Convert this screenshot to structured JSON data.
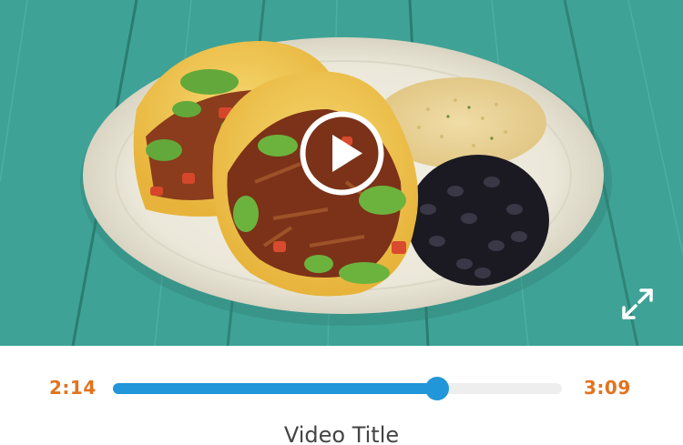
{
  "player": {
    "current_time": "2:14",
    "total_time": "3:09",
    "progress": 0.7228,
    "title": "Video Title"
  },
  "colors": {
    "accent": "#2196d8",
    "time_text": "#e2731f",
    "track_bg": "#eeeeee",
    "title_text": "#444444"
  },
  "icons": {
    "play": "play-icon",
    "fullscreen": "fullscreen-icon"
  }
}
